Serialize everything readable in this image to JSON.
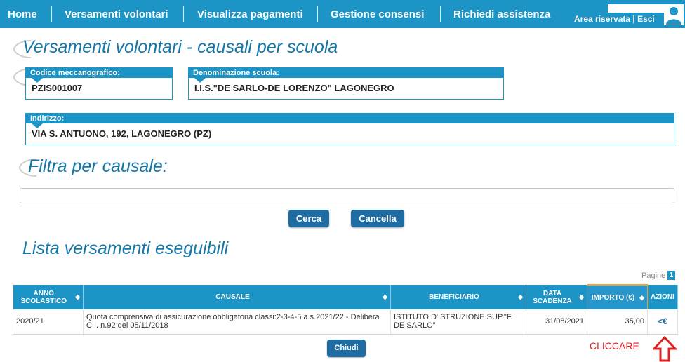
{
  "nav": {
    "items": [
      "Home",
      "Versamenti volontari",
      "Visualizza pagamenti",
      "Gestione consensi",
      "Richiedi assistenza"
    ],
    "area": "Area riservata | Esci",
    "icons": {
      "avatar": "user-icon"
    }
  },
  "colors": {
    "primary": "#1c94c6",
    "title": "#1477a8",
    "button": "#1f6ca2",
    "alert": "#e02020",
    "highlight": "#f0a030"
  },
  "page": {
    "title": "Versamenti volontari - causali per scuola"
  },
  "school": {
    "code_label": "Codice meccanografico:",
    "code": "PZIS001007",
    "name_label": "Denominazione scuola:",
    "name": "I.I.S.\"DE SARLO-DE LORENZO\" LAGONEGRO",
    "address_label": "Indirizzo:",
    "address": "VIA S. ANTUONO, 192, LAGONEGRO (PZ)"
  },
  "filter": {
    "title": "Filtra per causale:",
    "value": "",
    "search_label": "Cerca",
    "cancel_label": "Cancella"
  },
  "list": {
    "title": "Lista versamenti eseguibili",
    "pager_label": "Pagine",
    "pager_page": "1",
    "columns": [
      "ANNO SCOLASTICO",
      "CAUSALE",
      "BENEFICIARIO",
      "DATA SCADENZA",
      "IMPORTO (€)",
      "AZIONI"
    ],
    "rows": [
      {
        "anno": "2020/21",
        "causale": "Quota comprensiva di assicurazione obbligatoria classi:2-3-4-5 a.s.2021/22 - Delibera C.I. n.92 del 05/11/2018",
        "beneficiario": "ISTITUTO D'ISTRUZIONE SUP.\"F. DE SARLO\"",
        "scadenza": "31/08/2021",
        "importo": "35,00",
        "azione": "<€"
      }
    ],
    "close_label": "Chiudi"
  },
  "annotation": {
    "text": "CLICCARE",
    "icon": "arrow-up-icon"
  }
}
